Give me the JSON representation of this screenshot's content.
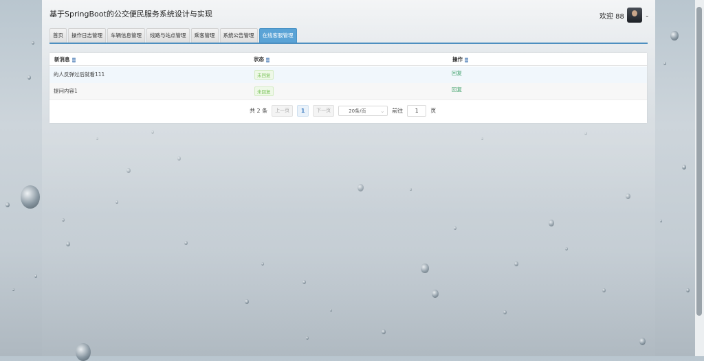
{
  "app": {
    "title": "基于SpringBoot的公交便民服务系统设计与实现",
    "welcome": "欢迎 88"
  },
  "tabs": [
    {
      "label": "首页"
    },
    {
      "label": "操作日志管理"
    },
    {
      "label": "车辆信息管理"
    },
    {
      "label": "线路与站点管理"
    },
    {
      "label": "乘客管理"
    },
    {
      "label": "系统公告管理"
    },
    {
      "label": "在线客服管理",
      "active": true
    }
  ],
  "table": {
    "headers": [
      "新消息",
      "状态",
      "操作"
    ],
    "rows": [
      {
        "message": "的人反弹过后就看111",
        "status": "未回复",
        "action": "回复"
      },
      {
        "message": "提问内容1",
        "status": "未回复",
        "action": "回复"
      }
    ]
  },
  "pagination": {
    "total": "共 2 条",
    "prev": "上一页",
    "page": "1",
    "next": "下一页",
    "page_size": "20条/页",
    "goto": "前往",
    "goto_value": "1",
    "page_unit": "页"
  },
  "colors": {
    "accent": "#4d8fc0",
    "active_tab": "#5aa3d6",
    "status_green": "#7cc35c",
    "reply_link": "#3fa06a"
  }
}
